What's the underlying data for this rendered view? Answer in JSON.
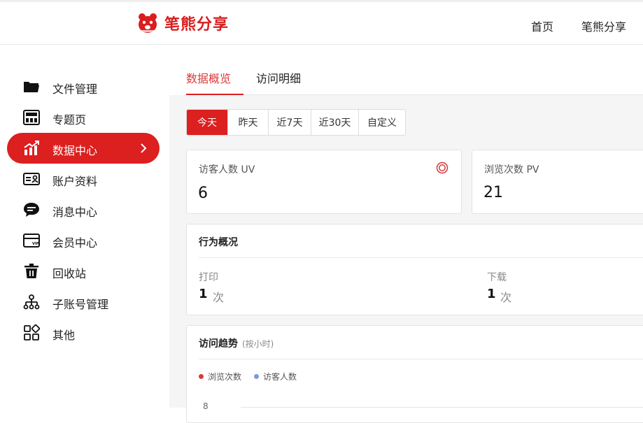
{
  "header": {
    "brand": "笔熊分享",
    "nav": [
      "首页",
      "笔熊分享"
    ]
  },
  "sidebar": {
    "items": [
      {
        "label": "文件管理",
        "icon": "folder-icon",
        "active": false
      },
      {
        "label": "专题页",
        "icon": "topic-page-icon",
        "active": false
      },
      {
        "label": "数据中心",
        "icon": "chart-icon",
        "active": true
      },
      {
        "label": "账户资料",
        "icon": "id-card-icon",
        "active": false
      },
      {
        "label": "消息中心",
        "icon": "message-icon",
        "active": false
      },
      {
        "label": "会员中心",
        "icon": "vip-card-icon",
        "active": false
      },
      {
        "label": "回收站",
        "icon": "trash-icon",
        "active": false
      },
      {
        "label": "子账号管理",
        "icon": "sub-account-icon",
        "active": false
      },
      {
        "label": "其他",
        "icon": "apps-icon",
        "active": false
      }
    ]
  },
  "tabs": [
    {
      "label": "数据概览",
      "active": true
    },
    {
      "label": "访问明细",
      "active": false
    }
  ],
  "date_range": {
    "options": [
      "今天",
      "昨天",
      "近7天",
      "近30天",
      "自定义"
    ],
    "selected": "今天"
  },
  "metrics": {
    "uv": {
      "label": "访客人数 UV",
      "value": "6"
    },
    "pv": {
      "label": "浏览次数 PV",
      "value": "21"
    }
  },
  "behavior": {
    "title": "行为概况",
    "print": {
      "label": "打印",
      "value": "1",
      "unit": "次"
    },
    "download": {
      "label": "下载",
      "value": "1",
      "unit": "次"
    }
  },
  "trend": {
    "title": "访问趋势",
    "subtitle": "(按小时)",
    "legend": [
      {
        "name": "浏览次数",
        "color": "#d83a3a"
      },
      {
        "name": "访客人数",
        "color": "#7a9bd6"
      }
    ],
    "first_tick": "8"
  },
  "colors": {
    "accent": "#dc1f1f"
  }
}
